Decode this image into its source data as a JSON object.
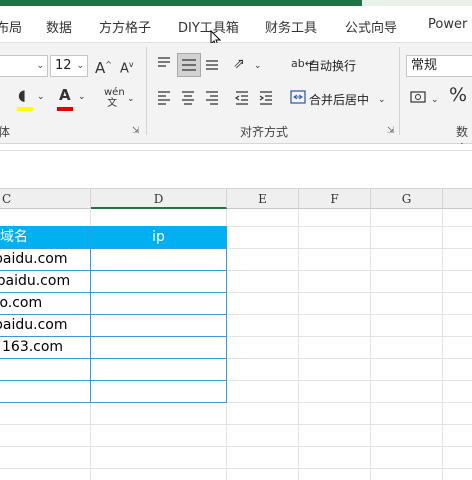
{
  "tabs": [
    "布局",
    "数据",
    "方方格子",
    "DIY工具箱",
    "财务工具",
    "公式向导",
    "Power P"
  ],
  "font": {
    "size": "12",
    "grow_icon": "font-grow-icon",
    "shrink_icon": "font-shrink-icon",
    "fill_color": "#ffff00",
    "font_color": "#e00000"
  },
  "alignment": {
    "wrap_text": "自动换行",
    "merge_center": "合并后居中",
    "group_label": "对齐方式"
  },
  "number": {
    "format": "常规",
    "group_label": "数字"
  },
  "font_group_label": "体",
  "columns": [
    "C",
    "D",
    "E",
    "F",
    "G"
  ],
  "table": {
    "header": [
      "域名",
      "ip"
    ],
    "rows": [
      [
        "baidu.com",
        ""
      ],
      [
        "w.baidu.com",
        ""
      ],
      [
        "hao.com",
        ""
      ],
      [
        "baidu.com",
        ""
      ],
      [
        "163.com",
        ""
      ],
      [
        "",
        ""
      ],
      [
        "",
        ""
      ]
    ]
  }
}
